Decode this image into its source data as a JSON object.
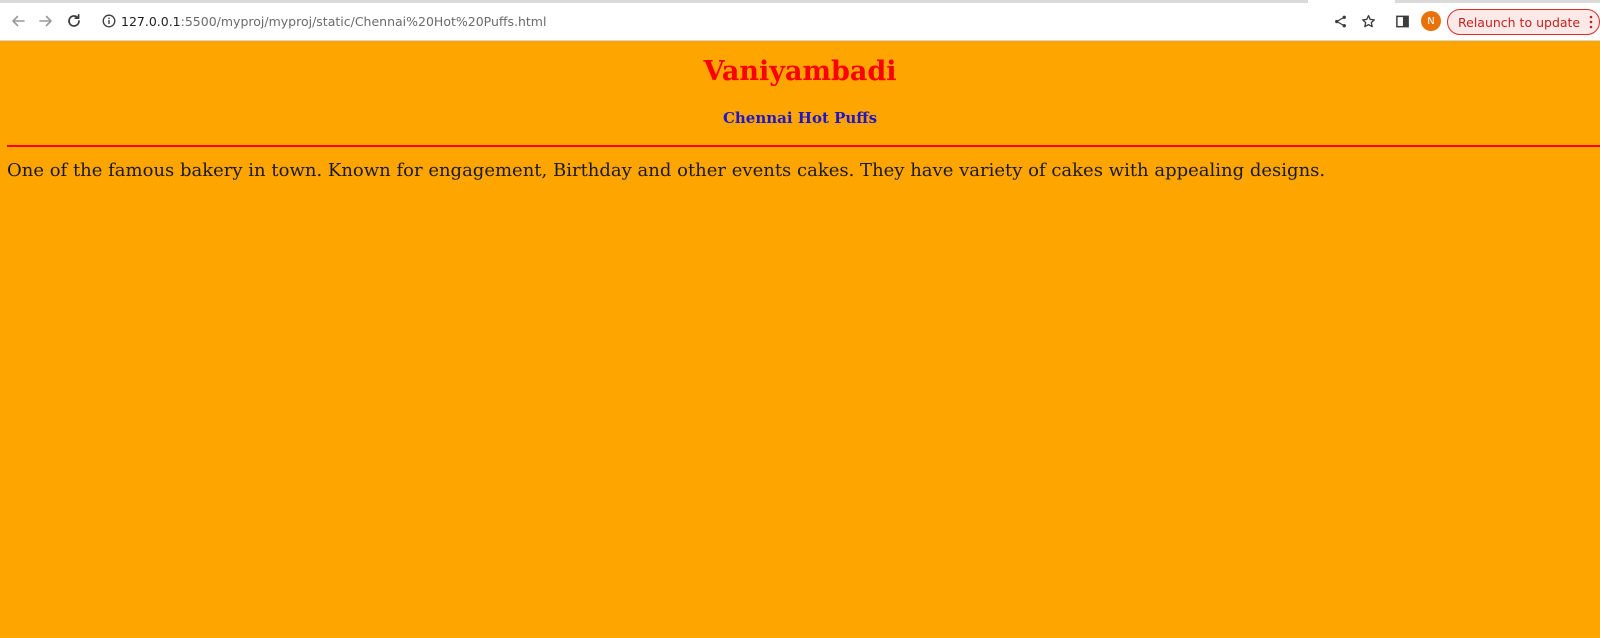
{
  "browser": {
    "url_host": "127.0.0.1",
    "url_rest": ":5500/myproj/myproj/static/Chennai%20Hot%20Puffs.html",
    "icons": {
      "back": "arrow-left-icon",
      "forward": "arrow-right-icon",
      "reload": "reload-icon",
      "info": "info-icon",
      "share": "share-icon",
      "bookmark": "star-icon",
      "side_panel": "side-panel-icon",
      "menu": "kebab-menu-icon"
    },
    "profile_initial": "N",
    "relaunch_label": "Relaunch to update",
    "colors": {
      "avatar": "#e8710a",
      "relaunch_text": "#c5221f"
    }
  },
  "page": {
    "heading": "Vaniyambadi",
    "subheading": "Chennai Hot Puffs",
    "description": "One of the famous bakery in town. Known for engagement, Birthday and other events cakes. They have variety of cakes with appealing designs.",
    "colors": {
      "background": "#ffa500",
      "heading": "#ff0000",
      "subheading": "#1f16c8",
      "divider": "#ff0000"
    }
  }
}
